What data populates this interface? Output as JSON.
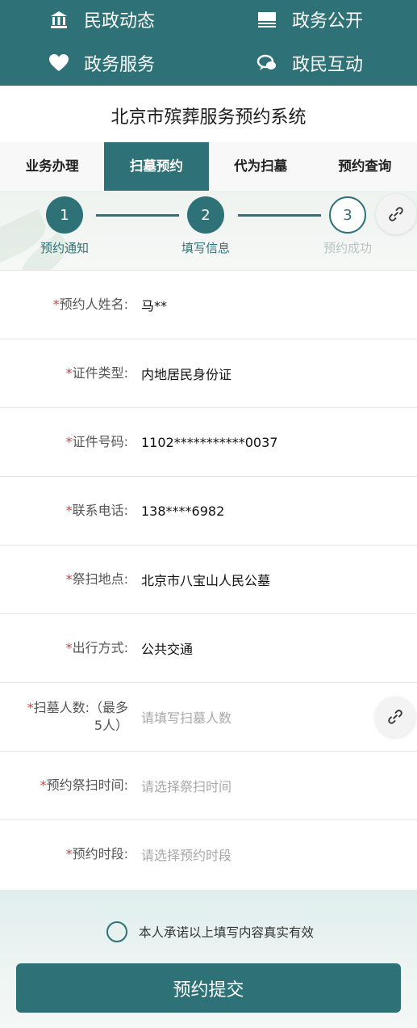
{
  "nav": {
    "items": [
      {
        "label": "民政动态",
        "icon": "building-icon"
      },
      {
        "label": "政务公开",
        "icon": "list-icon"
      },
      {
        "label": "政务服务",
        "icon": "heart-icon"
      },
      {
        "label": "政民互动",
        "icon": "chat-icon"
      }
    ]
  },
  "page_title": "北京市殡葬服务预约系统",
  "tabs": [
    {
      "label": "业务办理",
      "active": false
    },
    {
      "label": "扫墓预约",
      "active": true
    },
    {
      "label": "代为扫墓",
      "active": false
    },
    {
      "label": "预约查询",
      "active": false
    }
  ],
  "steps": [
    {
      "num": "1",
      "label": "预约通知",
      "state": "done"
    },
    {
      "num": "2",
      "label": "填写信息",
      "state": "done"
    },
    {
      "num": "3",
      "label": "预约成功",
      "state": "todo"
    }
  ],
  "form": {
    "required_mark": "*",
    "rows": [
      {
        "label": "预约人姓名:",
        "value": "马**",
        "placeholder": false
      },
      {
        "label": "证件类型:",
        "value": "内地居民身份证",
        "placeholder": false
      },
      {
        "label": "证件号码:",
        "value": "1102***********0037",
        "placeholder": false
      },
      {
        "label": "联系电话:",
        "value": "138****6982",
        "placeholder": false
      },
      {
        "label": "祭扫地点:",
        "value": "北京市八宝山人民公墓",
        "placeholder": false
      },
      {
        "label": "出行方式:",
        "value": "公共交通",
        "placeholder": false
      },
      {
        "label": "扫墓人数:（最多5人）",
        "value": "请填写扫墓人数",
        "placeholder": true
      },
      {
        "label": "预约祭扫时间:",
        "value": "请选择祭扫时间",
        "placeholder": true
      },
      {
        "label": "预约时段:",
        "value": "请选择预约时段",
        "placeholder": true
      }
    ]
  },
  "agree_text": "本人承诺以上填写内容真实有效",
  "submit_label": "预约提交",
  "colors": {
    "primary": "#2e7277",
    "required": "#d93d3d"
  }
}
